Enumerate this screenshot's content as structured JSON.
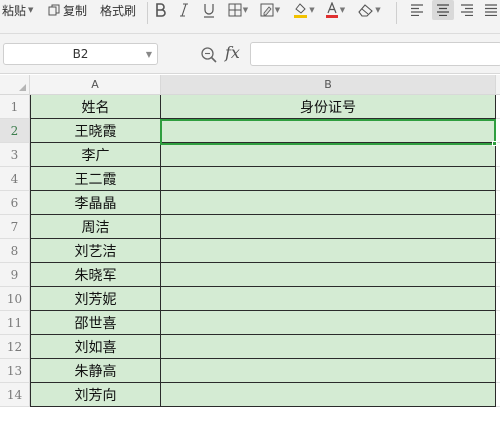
{
  "toolbar": {
    "paste_label": "粘贴",
    "copy_label": "复制",
    "format_painter_label": "格式刷"
  },
  "formula_bar": {
    "name_box": "B2",
    "fx_label": "fx",
    "formula_value": ""
  },
  "columns": [
    "A",
    "B"
  ],
  "rows": [
    {
      "num": "1",
      "a": "姓名",
      "b": "身份证号"
    },
    {
      "num": "2",
      "a": "王晓霞",
      "b": ""
    },
    {
      "num": "3",
      "a": "李广",
      "b": ""
    },
    {
      "num": "4",
      "a": "王二霞",
      "b": ""
    },
    {
      "num": "6",
      "a": "李晶晶",
      "b": ""
    },
    {
      "num": "7",
      "a": "周洁",
      "b": ""
    },
    {
      "num": "8",
      "a": "刘艺洁",
      "b": ""
    },
    {
      "num": "9",
      "a": "朱晓军",
      "b": ""
    },
    {
      "num": "10",
      "a": "刘芳妮",
      "b": ""
    },
    {
      "num": "11",
      "a": "邵世喜",
      "b": ""
    },
    {
      "num": "12",
      "a": "刘如喜",
      "b": ""
    },
    {
      "num": "13",
      "a": "朱静高",
      "b": ""
    },
    {
      "num": "14",
      "a": "刘芳向",
      "b": ""
    }
  ],
  "colors": {
    "cell_fill": "#d4ebd3",
    "selection_border": "#2f9e3f",
    "header_bg": "#f4f4f4"
  }
}
